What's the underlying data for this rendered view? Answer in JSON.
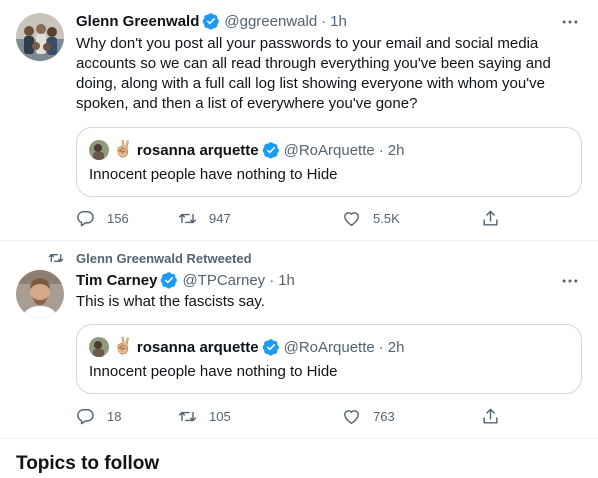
{
  "tweets": [
    {
      "author_name": "Glenn Greenwald",
      "handle": "@ggreenwald",
      "separator": "·",
      "time": "1h",
      "text": "Why don't you post all your passwords to your email and social media accounts so we can all read through everything you've been saying and doing, along with a full call log list showing everyone with whom you've spoken, and then a list of everywhere you've gone?",
      "quote": {
        "emoji": "✌🏼",
        "author_name": "rosanna arquette",
        "handle": "@RoArquette",
        "separator": "·",
        "time": "2h",
        "text": "Innocent people have nothing to Hide"
      },
      "stats": {
        "replies": "156",
        "retweets": "947",
        "likes": "5.5K"
      }
    },
    {
      "retweeted_by": "Glenn Greenwald Retweeted",
      "author_name": "Tim Carney",
      "handle": "@TPCarney",
      "separator": "·",
      "time": "1h",
      "text": "This is what the fascists say.",
      "quote": {
        "emoji": "✌🏼",
        "author_name": "rosanna arquette",
        "handle": "@RoArquette",
        "separator": "·",
        "time": "2h",
        "text": "Innocent people have nothing to Hide"
      },
      "stats": {
        "replies": "18",
        "retweets": "105",
        "likes": "763"
      }
    }
  ],
  "sections": {
    "topics_title": "Topics to follow"
  },
  "colors": {
    "verified": "#1d9bf0",
    "secondary_text": "#536471",
    "border": "#cfd9de"
  }
}
